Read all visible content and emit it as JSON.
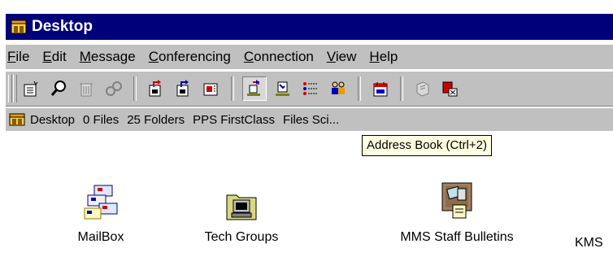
{
  "window": {
    "title": "Desktop"
  },
  "menu": [
    {
      "label": "File",
      "u": "F",
      "rest": "ile"
    },
    {
      "label": "Edit",
      "u": "E",
      "rest": "dit"
    },
    {
      "label": "Message",
      "u": "M",
      "rest": "essage"
    },
    {
      "label": "Conferencing",
      "u": "C",
      "rest": "onferencing"
    },
    {
      "label": "Connection",
      "u": "C",
      "rest": "onnection"
    },
    {
      "label": "View",
      "u": "V",
      "rest": "iew"
    },
    {
      "label": "Help",
      "u": "H",
      "rest": "elp"
    }
  ],
  "toolbar": {
    "buttons": [
      "new-document-icon",
      "find-icon",
      "delete-icon",
      "link-icon",
      "send-icon",
      "reply-icon",
      "forward-icon",
      "address-book-icon",
      "directory-icon",
      "history-icon",
      "collaborators-icon",
      "calendar-icon",
      "notes-icon",
      "quit-icon"
    ]
  },
  "status": {
    "location": "Desktop",
    "files": "0 Files",
    "folders": "25 Folders",
    "server": "PPS FirstClass",
    "extra": "Files Sci..."
  },
  "tooltip": {
    "text": "Address Book (Ctrl+2)"
  },
  "desktop": {
    "icons": [
      {
        "label": "MailBox"
      },
      {
        "label": "Tech Groups"
      },
      {
        "label": "MMS Staff Bulletins"
      },
      {
        "label": "KMS"
      }
    ]
  },
  "colors": {
    "title_bg": "#00007b",
    "chrome": "#c0c0c0",
    "tooltip_bg": "#ffffe1"
  }
}
